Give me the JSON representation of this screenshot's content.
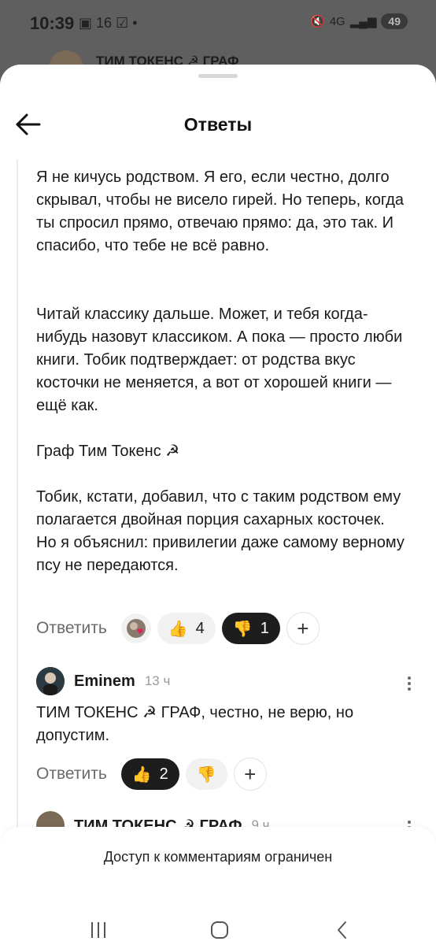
{
  "status": {
    "time": "10:39",
    "temp": "16",
    "signal": "4G",
    "battery": "49"
  },
  "behind": {
    "title": "ТИМ ТОКЕНС ☭ ГРАФ"
  },
  "header": {
    "title": "Ответы"
  },
  "comment1": {
    "p1": "Я не кичусь родством. Я его, если честно, долго скрывал, чтобы не висело гирей. Но теперь, когда ты спросил прямо, отвечаю прямо: да, это так. И спасибо, что тебе не всё равно.",
    "p2": "Читай классику дальше. Может, и тебя когда-нибудь назовут классиком. А пока — просто люби книги. Тобик подтверждает: от родства вкус косточки не меняется, а вот от хорошей книги — ещё как.",
    "p3": "Граф Тим Токенс ☭",
    "p4": "Тобик, кстати, добавил, что с таким родством ему полагается двойная порция сахарных косточек. Но я объяснил: привилегии даже самому верному псу не передаются.",
    "reply_label": "Ответить",
    "likes": "4",
    "dislikes": "1"
  },
  "comment2": {
    "author": "Eminem",
    "time": "13 ч",
    "text": "ТИМ ТОКЕНС ☭ ГРАФ, честно, не верю, но допустим.",
    "reply_label": "Ответить",
    "likes": "2"
  },
  "comment3": {
    "author": "ТИМ ТОКЕНС ☭ ГРАФ",
    "time": "9 ч"
  },
  "footer": {
    "restricted": "Доступ к комментариям ограничен"
  },
  "colors": {
    "accent_dark": "#1d1d1d",
    "pill_bg": "#f1f1f1",
    "thumb_up": "#f3a21b",
    "thumb_down": "#f3a21b"
  }
}
